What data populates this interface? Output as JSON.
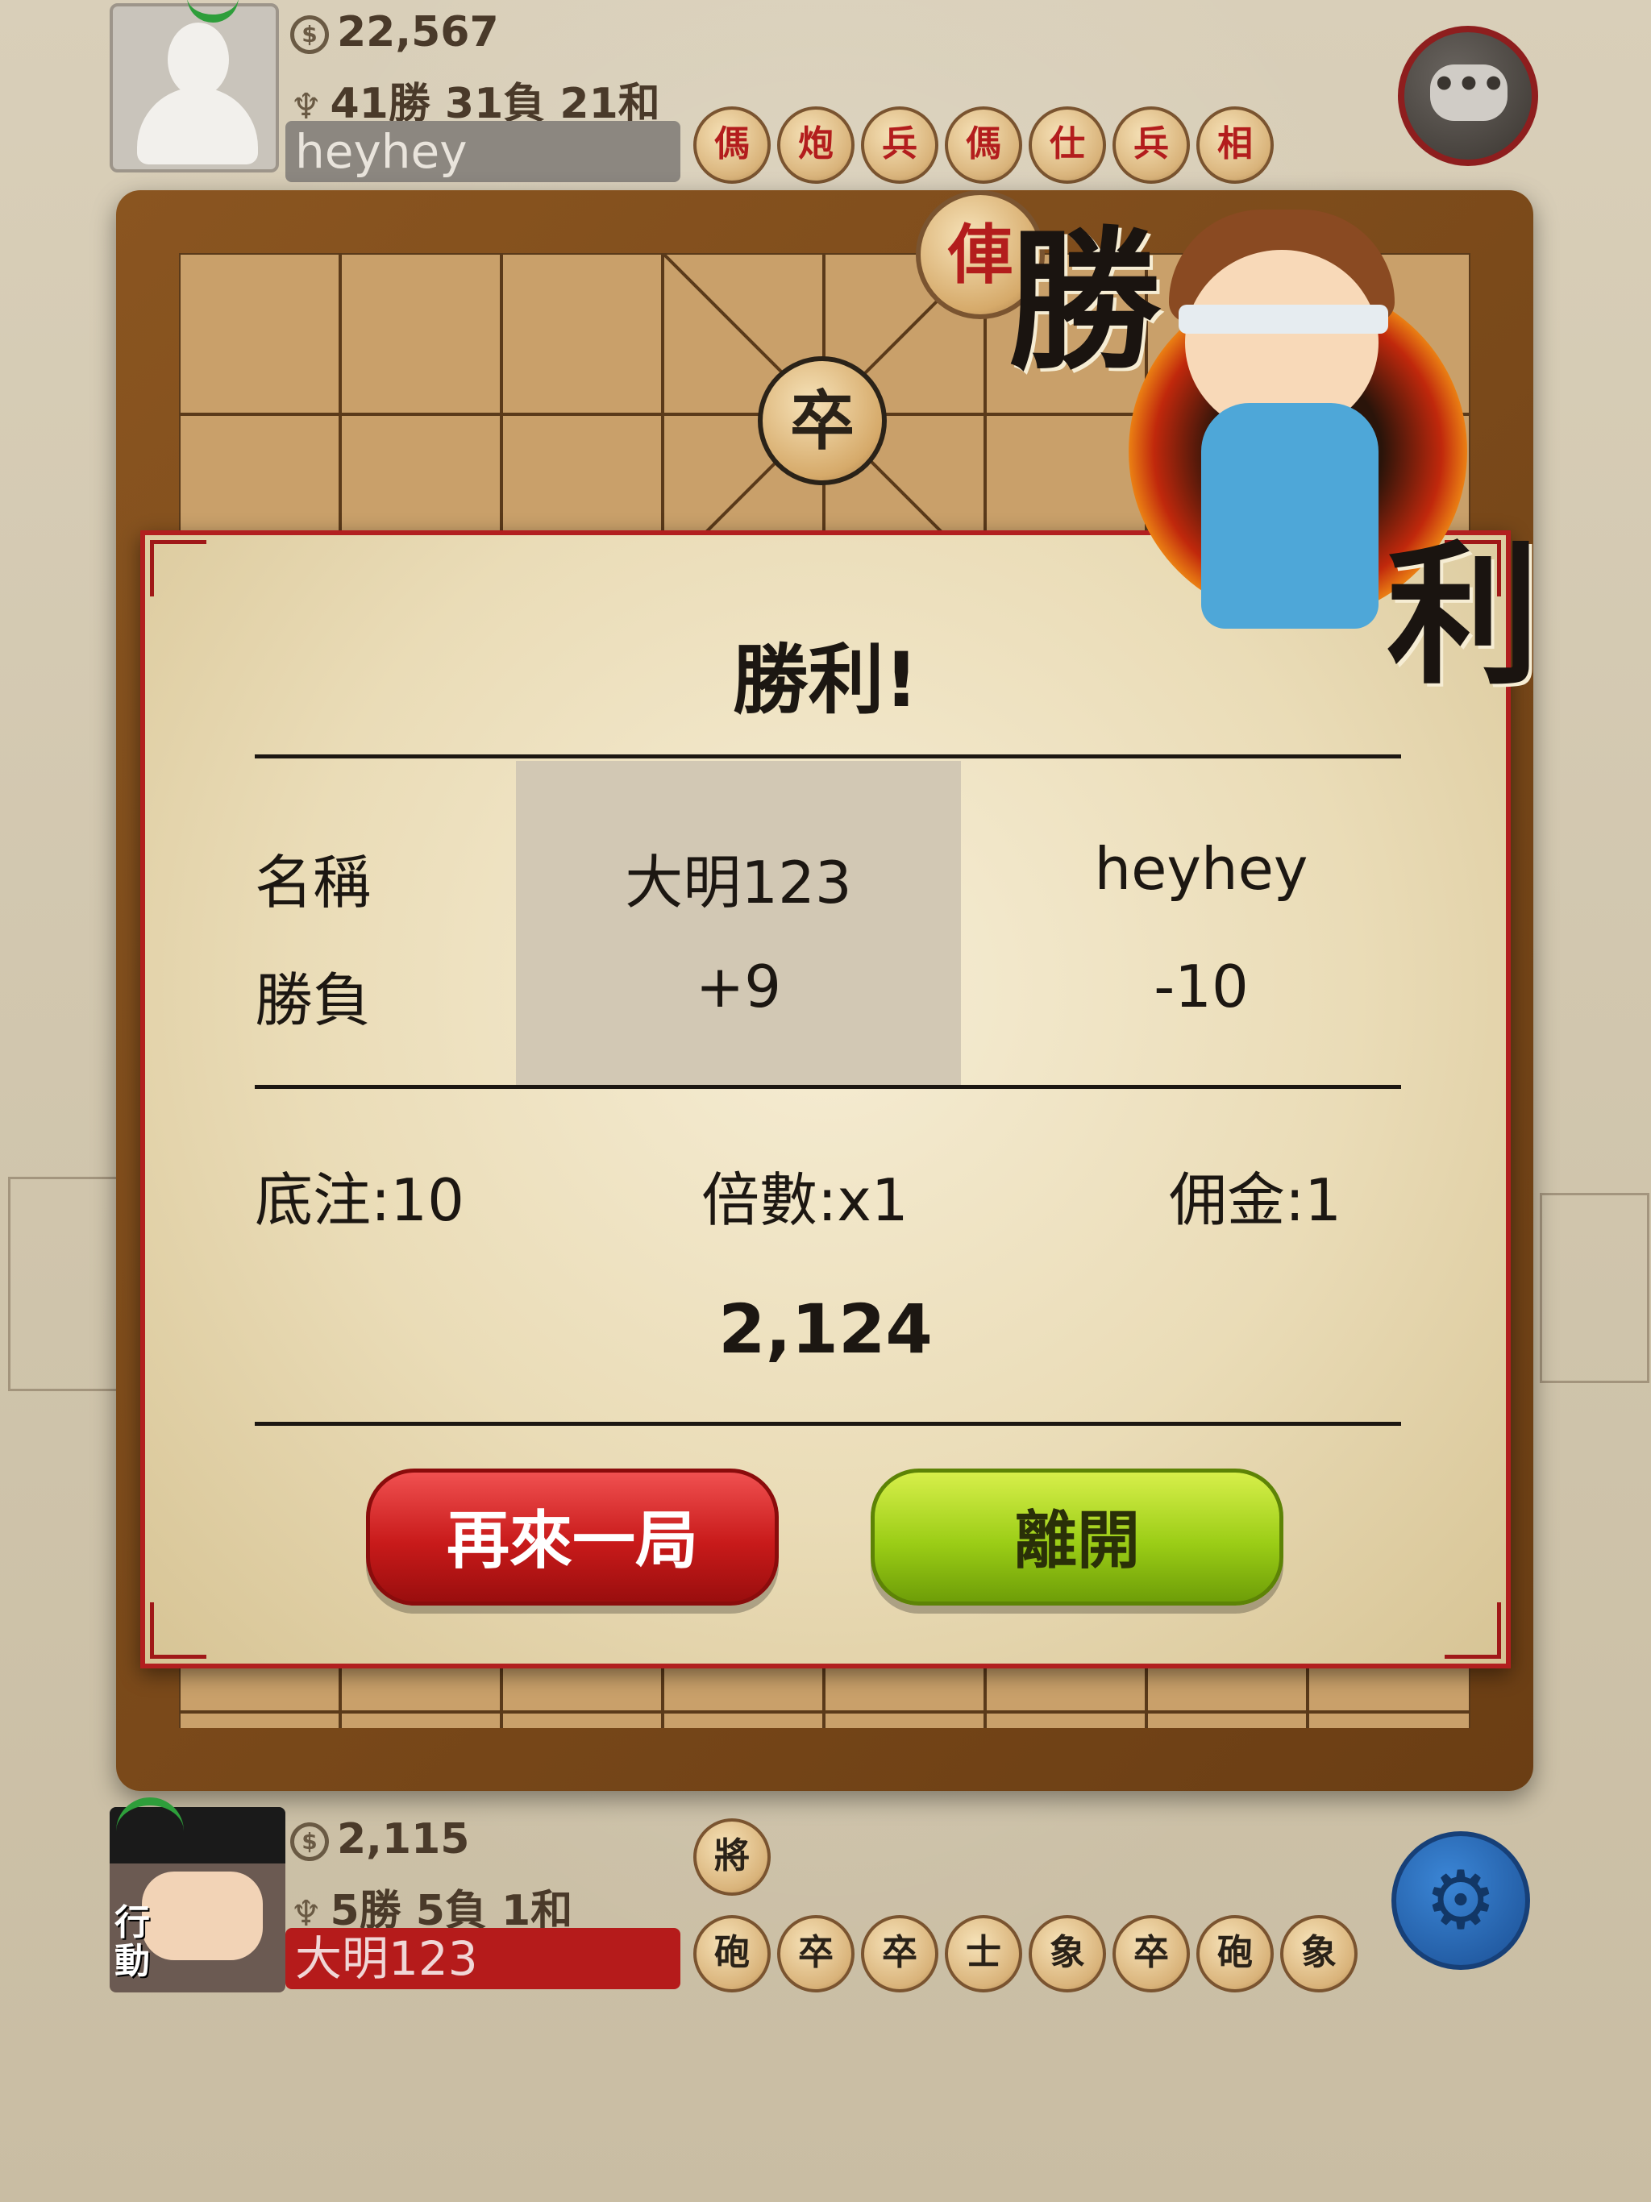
{
  "top_player": {
    "coins": "22,567",
    "record": "41勝 31負 21和",
    "name": "heyhey",
    "captured": [
      {
        "ch": "傌",
        "side": "red"
      },
      {
        "ch": "炮",
        "side": "red"
      },
      {
        "ch": "兵",
        "side": "red"
      },
      {
        "ch": "傌",
        "side": "red"
      },
      {
        "ch": "仕",
        "side": "red"
      },
      {
        "ch": "兵",
        "side": "red"
      },
      {
        "ch": "相",
        "side": "red"
      }
    ]
  },
  "chat": {
    "icon": "chat-bubble-icon",
    "glyph": "•••"
  },
  "board": {
    "pieces": [
      {
        "ch": "俥",
        "side": "red"
      },
      {
        "ch": "卒",
        "side": "black"
      }
    ]
  },
  "victory_art": {
    "char1": "勝",
    "char2": "利"
  },
  "dialog": {
    "title": "勝利!",
    "header_label_name": "名稱",
    "header_label_result": "勝負",
    "player1_name": "大明123",
    "player1_result": "+9",
    "player2_name": "heyhey",
    "player2_result": "-10",
    "base_bet": "底注:10",
    "multiplier": "倍數:x1",
    "commission": "佣金:1",
    "balance": "2,124",
    "replay_label": "再來一局",
    "leave_label": "離開"
  },
  "bottom_player": {
    "coins": "2,115",
    "record": "5勝 5負 1和",
    "name": "大明123",
    "action_tag": "行動",
    "general": {
      "ch": "將",
      "side": "black"
    },
    "captured": [
      {
        "ch": "砲",
        "side": "black"
      },
      {
        "ch": "卒",
        "side": "black"
      },
      {
        "ch": "卒",
        "side": "black"
      },
      {
        "ch": "士",
        "side": "black"
      },
      {
        "ch": "象",
        "side": "black"
      },
      {
        "ch": "卒",
        "side": "black"
      },
      {
        "ch": "砲",
        "side": "black"
      },
      {
        "ch": "象",
        "side": "black"
      }
    ]
  },
  "settings": {
    "icon": "gear-icon",
    "glyph": "⚙"
  },
  "colors": {
    "accent_red": "#b21f1f",
    "accent_green": "#9bcd16",
    "board_wood": "#8a5520"
  }
}
